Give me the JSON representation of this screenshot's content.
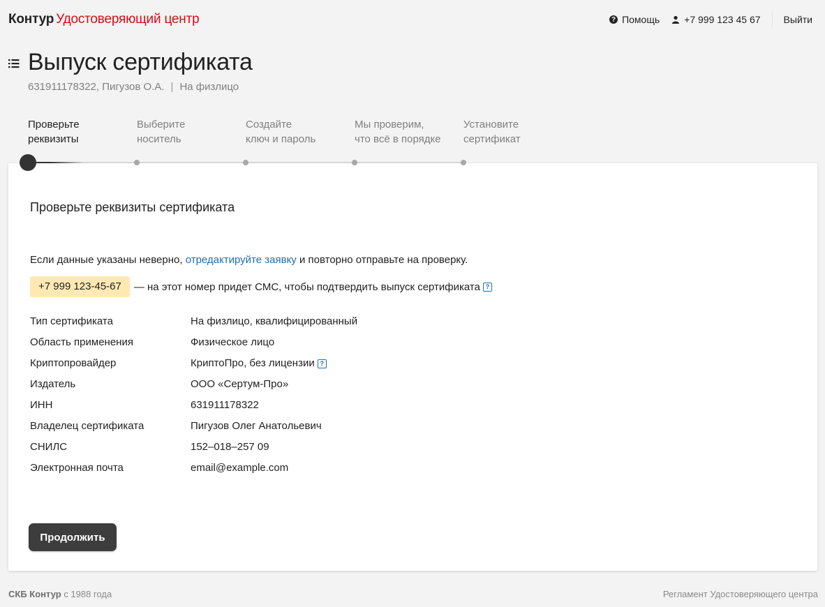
{
  "header": {
    "logo_brand": "Контур",
    "logo_product": "Удостоверяющий центр",
    "help_label": "Помощь",
    "user_phone": "+7 999 123 45 67",
    "logout_label": "Выйти",
    "help_icon": "question-circle-icon",
    "user_icon": "user-icon"
  },
  "page": {
    "title": "Выпуск сертификата",
    "subtitle_inn_name": "631911178322, Пигузов О.А.",
    "subtitle_separator": "|",
    "subtitle_type": "На физлицо",
    "menu_icon": "list-icon"
  },
  "steps": [
    {
      "line1": "Проверьте",
      "line2": "реквизиты",
      "active": true
    },
    {
      "line1": "Выберите",
      "line2": "носитель",
      "active": false
    },
    {
      "line1": "Создайте",
      "line2": "ключ и пароль",
      "active": false
    },
    {
      "line1": "Мы проверим,",
      "line2": "что всё в порядке",
      "active": false
    },
    {
      "line1": "Установите",
      "line2": "сертификат",
      "active": false
    }
  ],
  "card": {
    "title": "Проверьте реквизиты сертификата",
    "notice_before": "Если данные указаны неверно, ",
    "notice_link": "отредактируйте заявку",
    "notice_after": " и повторно отправьте на проверку.",
    "phone": "+7 999 123-45-67",
    "phone_note": "— на этот номер придет СМС, чтобы подтвердить выпуск сертификата",
    "help_icon_glyph": "?",
    "details": [
      {
        "key": "Тип сертификата",
        "value": "На физлицо, квалифицированный"
      },
      {
        "key": "Область применения",
        "value": "Физическое лицо"
      },
      {
        "key": "Криптопровайдер",
        "value": "КриптоПро, без лицензии",
        "has_help": true
      },
      {
        "key": "Издатель",
        "value": "ООО «Сертум-Про»"
      },
      {
        "key": "ИНН",
        "value": "631911178322"
      },
      {
        "key": "Владелец сертификата",
        "value": "Пигузов Олег Анатольевич"
      },
      {
        "key": "СНИЛС",
        "value": "152–018–257 09"
      },
      {
        "key": "Электронная почта",
        "value": "email@example.com"
      }
    ],
    "continue_label": "Продолжить"
  },
  "footer": {
    "company": "СКБ Контур",
    "since": " с 1988 года",
    "regulation_link": "Регламент Удостоверяющего центра"
  },
  "colors": {
    "brand_red": "#d70c17",
    "link_blue": "#1f6fb5",
    "phone_highlight": "#ffe9b3",
    "button_dark": "#3d3d3d"
  }
}
